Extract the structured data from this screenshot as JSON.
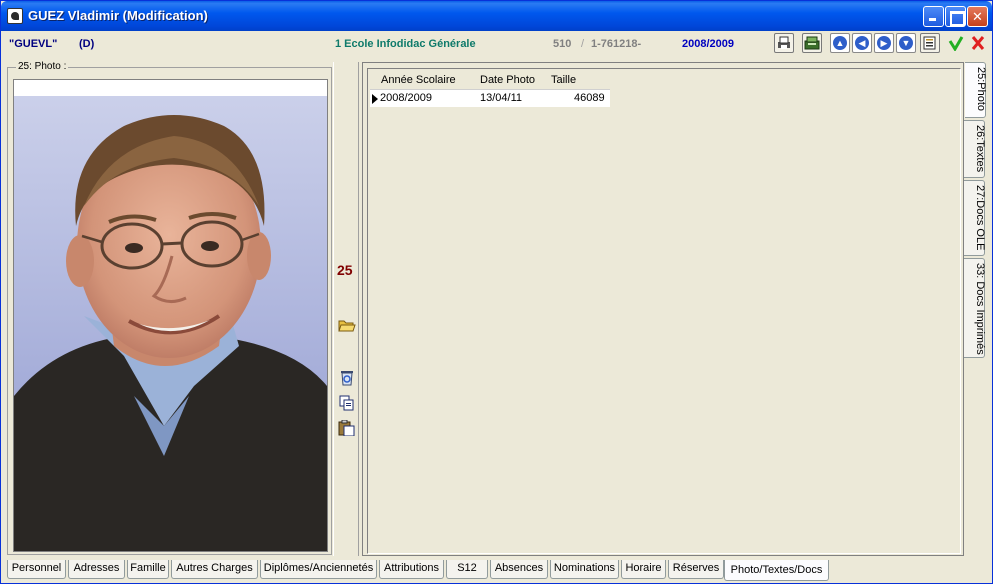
{
  "window": {
    "title": "GUEZ Vladimir (Modification)"
  },
  "header": {
    "code": "\"GUEVL\"",
    "flag": "(D)",
    "school": "1 Ecole Infodidac Générale",
    "number": "510",
    "separator": "/",
    "reference": "1-761218-",
    "year": "2008/2009",
    "colors": {
      "code": "#000080",
      "school": "#0E7A6A",
      "number": "#808080",
      "year": "#0000C0"
    }
  },
  "photo": {
    "legend": "25: Photo :"
  },
  "sidebar": {
    "number": "25"
  },
  "grid": {
    "columns": [
      "Année Scolaire",
      "Date Photo",
      "Taille"
    ],
    "rows": [
      {
        "annee": "2008/2009",
        "date": "13/04/11",
        "taille": "46089"
      }
    ]
  },
  "vtabs": [
    "25:Photo",
    "26:Textes",
    "27:Docs OLE",
    "33: Docs Imprimés"
  ],
  "tabs": [
    "Personnel",
    "Adresses",
    "Famille",
    "Autres Charges",
    "Diplômes/Anciennetés",
    "Attributions",
    "S12",
    "Absences",
    "Nominations",
    "Horaire",
    "Réserves",
    "Photo/Textes/Docs"
  ],
  "active_tab": "Photo/Textes/Docs"
}
